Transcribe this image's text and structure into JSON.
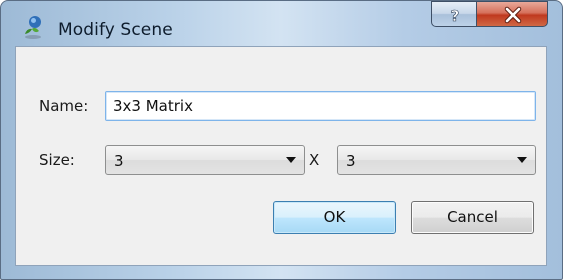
{
  "window": {
    "title": "Modify Scene",
    "icon": "scene-app-icon",
    "help_icon": "help-icon",
    "close_icon": "close-icon"
  },
  "form": {
    "name_label": "Name:",
    "name_value": "3x3 Matrix",
    "size_label": "Size:",
    "size_rows_value": "3",
    "size_separator": "X",
    "size_cols_value": "3"
  },
  "buttons": {
    "ok_label": "OK",
    "cancel_label": "Cancel"
  },
  "colors": {
    "titlebar": "#b9d1e8",
    "close_button": "#c0391f",
    "focus_border": "#7eb4ea",
    "default_button": "#bee6fd"
  }
}
